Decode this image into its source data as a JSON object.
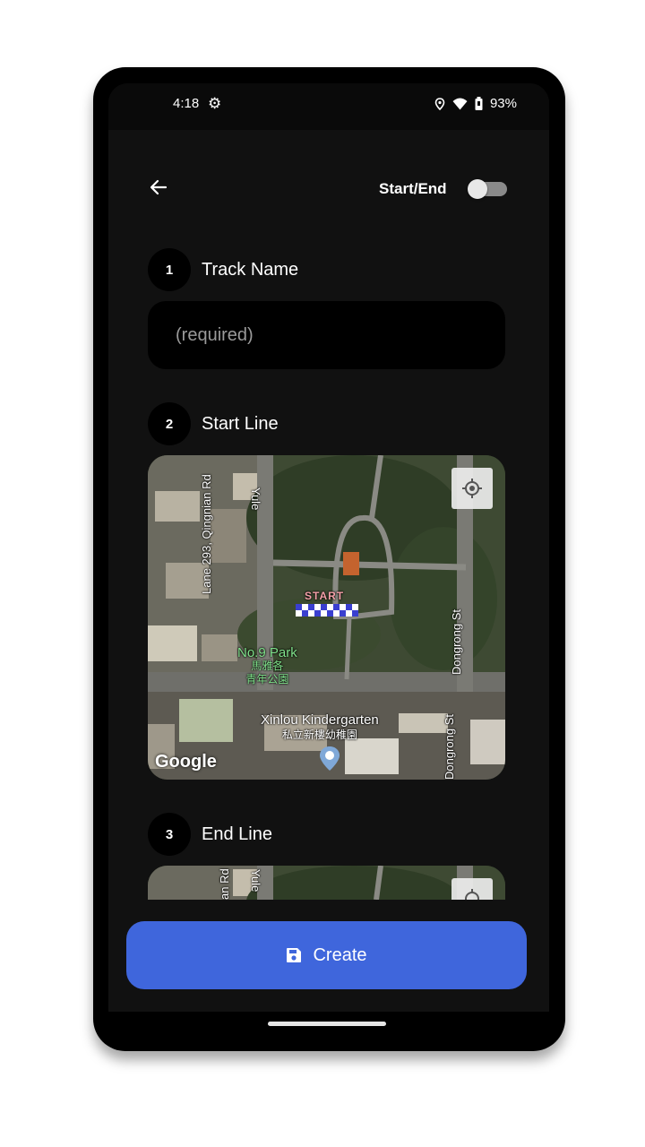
{
  "status_bar": {
    "time": "4:18",
    "battery": "93%",
    "icons": [
      "settings-gear-icon",
      "location-icon",
      "wifi-icon",
      "battery-icon"
    ]
  },
  "header": {
    "back_icon": "arrow-left-icon",
    "toggle_label": "Start/End",
    "toggle_on": false
  },
  "steps": [
    {
      "number": "1",
      "label": "Track Name"
    },
    {
      "number": "2",
      "label": "Start Line"
    },
    {
      "number": "3",
      "label": "End Line"
    }
  ],
  "track_name": {
    "value": "",
    "placeholder": "(required)"
  },
  "start_map": {
    "road_labels": [
      "Lane 293, Qingnian Rd",
      "Yule",
      "Dongrong St",
      "Dongrong St"
    ],
    "marker_text": "START",
    "park_name": "No.9 Park",
    "park_name_zh": "馬雅各",
    "park_name_zh2": "青年公園",
    "poi_name": "Xinlou Kindergarten",
    "poi_name_zh": "私立新樓幼稚園",
    "attribution": "Google",
    "locate_icon": "my-location-icon"
  },
  "end_map": {
    "road_labels": [
      "an Rd",
      "Yule"
    ],
    "locate_icon": "my-location-icon"
  },
  "actions": {
    "create_label": "Create",
    "create_icon": "save-icon"
  },
  "colors": {
    "background": "#111111",
    "accent": "#3f66dc",
    "park_label": "#7fe08a"
  }
}
